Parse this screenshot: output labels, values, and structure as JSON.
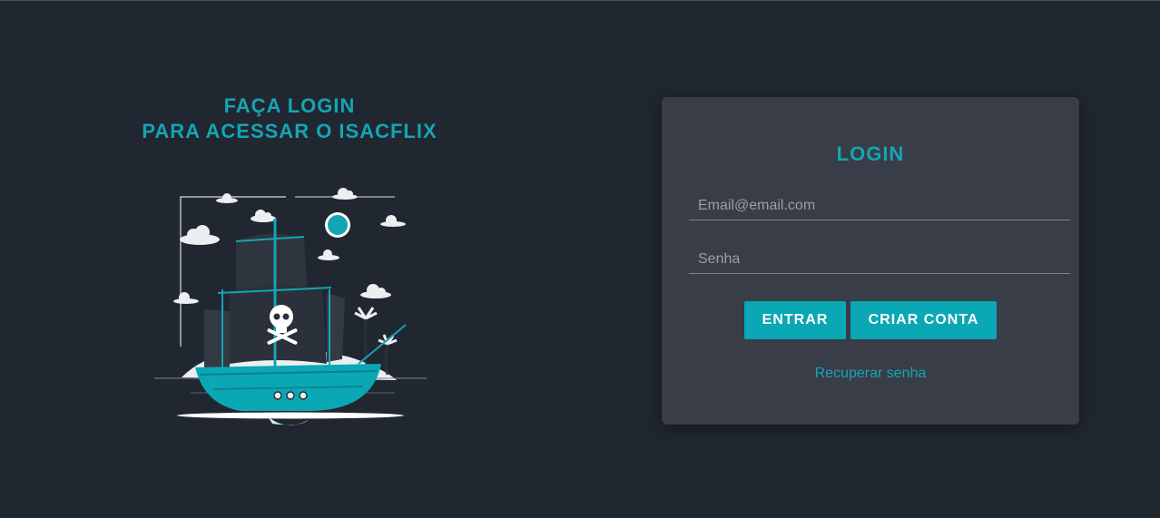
{
  "left_panel": {
    "heading_line1": "FAÇA LOGIN",
    "heading_line2": "PARA ACESSAR O ISACFLIX",
    "illustration": "pirate-ship-illustration"
  },
  "login_card": {
    "title": "LOGIN",
    "email_placeholder": "Email@email.com",
    "email_value": "",
    "password_placeholder": "Senha",
    "password_value": "",
    "login_button": "ENTRAR",
    "signup_button": "CRIAR CONTA",
    "recover_link": "Recuperar senha"
  },
  "colors": {
    "background": "#212731",
    "card": "#393d48",
    "accent": "#14a5b4",
    "button": "#0aa7b4"
  }
}
